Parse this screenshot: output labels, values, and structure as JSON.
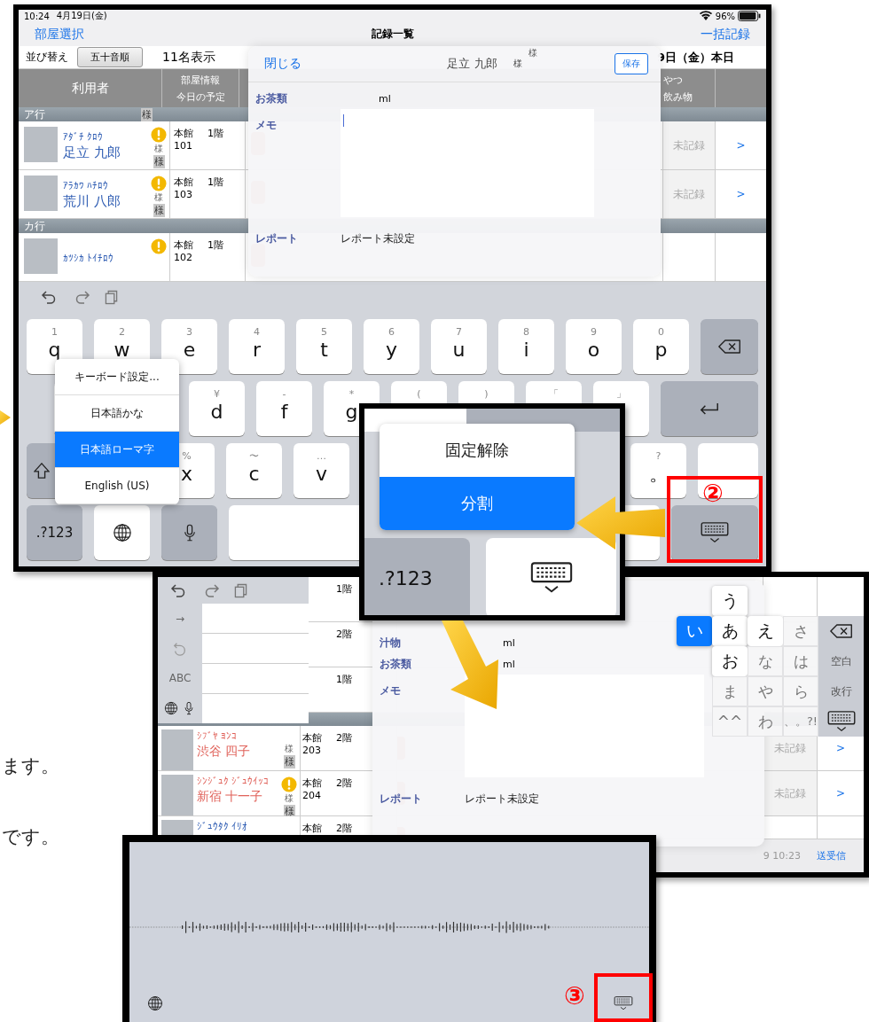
{
  "side_text": [
    "ます。",
    "です。"
  ],
  "screen_1": {
    "status_bar": {
      "time": "10:24",
      "date": "4月19日(金)",
      "battery": "96%"
    },
    "nav_bar": {
      "left": "部屋選択",
      "title": "記録一覧",
      "right": "一括記録"
    },
    "sort_bar": {
      "label": "並び替え",
      "button": "五十音順",
      "count": "11名表示",
      "date": "9日（金）本日"
    },
    "table_header": {
      "user": "利用者",
      "room_info": "部屋情報",
      "schedule": "今日の予定",
      "column_3": "やつ",
      "column_4": "飲み物"
    },
    "sections": [
      {
        "title": "ア行",
        "tag": "様",
        "rows": [
          {
            "kana": "ｱﾀﾞﾁ ｸﾛｳ",
            "name": "足立 九郎",
            "color": "#2f5db3",
            "alert": true,
            "honorific": "様",
            "tag": "様",
            "building": "本館",
            "floor": "1階",
            "room": "101",
            "status": "未記録",
            "more": ">"
          },
          {
            "kana": "ｱﾗｶﾜ ﾊﾁﾛｳ",
            "name": "荒川 八郎",
            "color": "#2f5db3",
            "alert": true,
            "honorific": "様",
            "tag": "様",
            "building": "本館",
            "floor": "1階",
            "room": "103",
            "status": "未記録",
            "more": ">"
          }
        ]
      },
      {
        "title": "カ行",
        "rows": [
          {
            "kana": "ｶﾂｼｶ ﾄｲﾁﾛｳ",
            "color": "#2f5db3",
            "alert": true,
            "building": "本館",
            "floor": "1階",
            "room": "102"
          }
        ]
      }
    ],
    "modal": {
      "top_tag": "様",
      "close": "閉じる",
      "title": "足立 九郎",
      "title_suffix": "様",
      "save": "保存",
      "fields": [
        {
          "label": "お茶類",
          "value": "ml"
        }
      ],
      "memo_label": "メモ",
      "report_label": "レポート",
      "report_value": "レポート未設定"
    },
    "keyboard": {
      "rows": [
        [
          {
            "kind": "char",
            "hint": "1",
            "label": "q"
          },
          {
            "kind": "char",
            "hint": "2",
            "label": "w"
          },
          {
            "kind": "char",
            "hint": "3",
            "label": "e"
          },
          {
            "kind": "char",
            "hint": "4",
            "label": "r"
          },
          {
            "kind": "char",
            "hint": "5",
            "label": "t"
          },
          {
            "kind": "char",
            "hint": "6",
            "label": "y"
          },
          {
            "kind": "char",
            "hint": "7",
            "label": "u"
          },
          {
            "kind": "char",
            "hint": "8",
            "label": "i"
          },
          {
            "kind": "char",
            "hint": "9",
            "label": "o"
          },
          {
            "kind": "char",
            "hint": "0",
            "label": "p"
          },
          {
            "kind": "delete"
          }
        ],
        [
          {
            "kind": "blank"
          },
          {
            "kind": "blank"
          },
          {
            "kind": "char",
            "hint": "¥",
            "label": "d"
          },
          {
            "kind": "char",
            "hint": "-",
            "label": "f"
          },
          {
            "kind": "char",
            "hint": "*",
            "label": "g"
          },
          {
            "kind": "char",
            "hint": "("
          },
          {
            "kind": "char",
            "hint": ")"
          },
          {
            "kind": "char",
            "hint": "「"
          },
          {
            "kind": "char",
            "hint": "」"
          },
          {
            "kind": "return"
          }
        ],
        [
          {
            "kind": "shift"
          },
          {
            "kind": "blank"
          },
          {
            "kind": "char",
            "hint": "%",
            "label": "x"
          },
          {
            "kind": "char",
            "hint": "〜",
            "label": "c"
          },
          {
            "kind": "char",
            "hint": "…",
            "label": "v"
          },
          {
            "kind": "blank"
          },
          {
            "kind": "blank"
          },
          {
            "kind": "blank"
          },
          {
            "kind": "blank"
          },
          {
            "kind": "char",
            "hint": "?",
            "label": "。"
          },
          {
            "kind": "blank"
          }
        ],
        [
          {
            "kind": "mode",
            "label": ".?123"
          },
          {
            "kind": "globe"
          },
          {
            "kind": "mic"
          },
          {
            "kind": "space"
          },
          {
            "kind": "hide"
          }
        ]
      ],
      "language_menu": [
        {
          "label": "キーボード設定...",
          "selected": false
        },
        {
          "label": "日本語かな",
          "selected": false
        },
        {
          "label": "日本語ローマ字",
          "selected": true
        },
        {
          "label": "English (US)",
          "selected": false
        }
      ]
    },
    "callout": "②"
  },
  "inset": {
    "menu": [
      {
        "label": "固定解除",
        "selected": false
      },
      {
        "label": "分割",
        "selected": true
      }
    ],
    "keys": [
      {
        "kind": "mode",
        "label": ".?123"
      },
      {
        "kind": "hide"
      }
    ]
  },
  "screen_2": {
    "split_keys": [
      {
        "kind": "char",
        "label": "→"
      },
      {
        "kind": "undo"
      },
      {
        "kind": "char",
        "label": "ABC"
      },
      {
        "kind": "globe_mic"
      }
    ],
    "rows_above": [
      {
        "floor": "1階"
      },
      {
        "floor": "2階"
      },
      {
        "floor": "1階"
      }
    ],
    "rows": [
      {
        "kana": "ｼﾌﾞﾔ ﾖﾝｺ",
        "name": "渋谷 四子",
        "color": "#e0625a",
        "honorific": "様",
        "tag": "様",
        "building": "本館",
        "floor": "2階",
        "room": "203",
        "status": "未記録",
        "more": ">"
      },
      {
        "kana": "ｼﾝｼﾞｭｸ ｼﾞｭｳｲｯｺ",
        "name": "新宿 十一子",
        "color": "#e0625a",
        "alert": true,
        "honorific": "様",
        "tag": "様",
        "building": "本館",
        "floor": "2階",
        "room": "204",
        "status": "未記録",
        "more": ">"
      },
      {
        "kana": "ｼﾞｭｳﾀｸ ｲﾘｵ",
        "color": "#2f5db3",
        "building": "本館",
        "floor": "2階"
      }
    ],
    "modal": {
      "fields": [
        {
          "label": "汁物",
          "value": "ml"
        },
        {
          "label": "お茶類",
          "value": "ml"
        }
      ],
      "memo_label": "メモ",
      "report_label": "レポート",
      "report_value": "レポート未設定"
    },
    "kana_keys": [
      {
        "kind": "empty"
      },
      {
        "kind": "flick",
        "label": "う",
        "selected": false
      },
      {
        "kind": "empty"
      },
      {
        "kind": "empty"
      },
      {
        "kind": "empty"
      },
      {
        "kind": "flick",
        "label": "い",
        "selected": true
      },
      {
        "kind": "flick",
        "label": "あ",
        "selected": false
      },
      {
        "kind": "flick",
        "label": "え",
        "selected": false
      },
      {
        "kind": "char",
        "label": "さ"
      },
      {
        "kind": "delete"
      },
      {
        "kind": "empty"
      },
      {
        "kind": "flick",
        "label": "お",
        "selected": false
      },
      {
        "kind": "char",
        "label": "な"
      },
      {
        "kind": "char",
        "label": "は"
      },
      {
        "kind": "func",
        "label": "空白"
      },
      {
        "kind": "empty"
      },
      {
        "kind": "char",
        "label": "ま"
      },
      {
        "kind": "char",
        "label": "や"
      },
      {
        "kind": "char",
        "label": "ら"
      },
      {
        "kind": "func",
        "label": "改行"
      },
      {
        "kind": "empty"
      },
      {
        "kind": "char",
        "label": "^^"
      },
      {
        "kind": "char",
        "label": "わ"
      },
      {
        "kind": "char",
        "label": "、。?!"
      },
      {
        "kind": "hide"
      }
    ],
    "bottom_bar": {
      "time": "9 10:23",
      "sync": "送受信"
    }
  },
  "screen_3": {
    "callout": "③"
  }
}
